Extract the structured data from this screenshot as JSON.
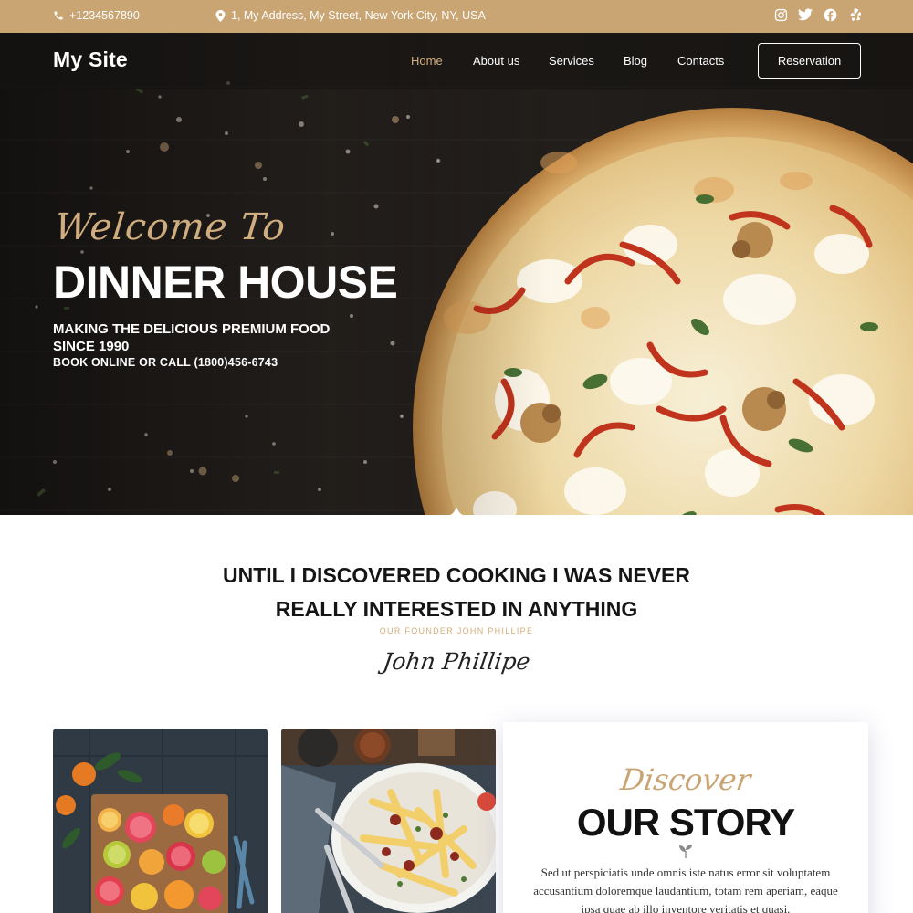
{
  "topbar": {
    "phone": "+1234567890",
    "address": "1, My Address, My Street, New York City, NY, USA",
    "socials": [
      "instagram-icon",
      "twitter-icon",
      "facebook-icon",
      "yelp-icon"
    ]
  },
  "nav": {
    "logo": "My Site",
    "items": [
      {
        "label": "Home",
        "active": true
      },
      {
        "label": "About us",
        "active": false
      },
      {
        "label": "Services",
        "active": false
      },
      {
        "label": "Blog",
        "active": false
      },
      {
        "label": "Contacts",
        "active": false
      }
    ],
    "reservation_label": "Reservation"
  },
  "hero": {
    "welcome": "Welcome To",
    "headline": "DINNER HOUSE",
    "subheading": "MAKING THE DELICIOUS PREMIUM FOOD SINCE 1990",
    "cta_text": "BOOK ONLINE OR CALL (1800)456-6743"
  },
  "quote": {
    "line1": "UNTIL I DISCOVERED COOKING I WAS NEVER",
    "line2": "REALLY INTERESTED IN ANYTHING",
    "founder": "OUR FOUNDER JOHN PHILLIPE",
    "signature": "John Phillipe"
  },
  "story": {
    "script": "Discover",
    "title": "OUR STORY",
    "text": "Sed ut perspiciatis unde omnis iste natus error sit voluptatem accusantium doloremque laudantium, totam rem aperiam, eaque ipsa quae ab illo inventore veritatis et quasi."
  },
  "colors": {
    "accent": "#c9a574",
    "nav_active": "#d4ae7b",
    "dark": "#1e1b19"
  }
}
